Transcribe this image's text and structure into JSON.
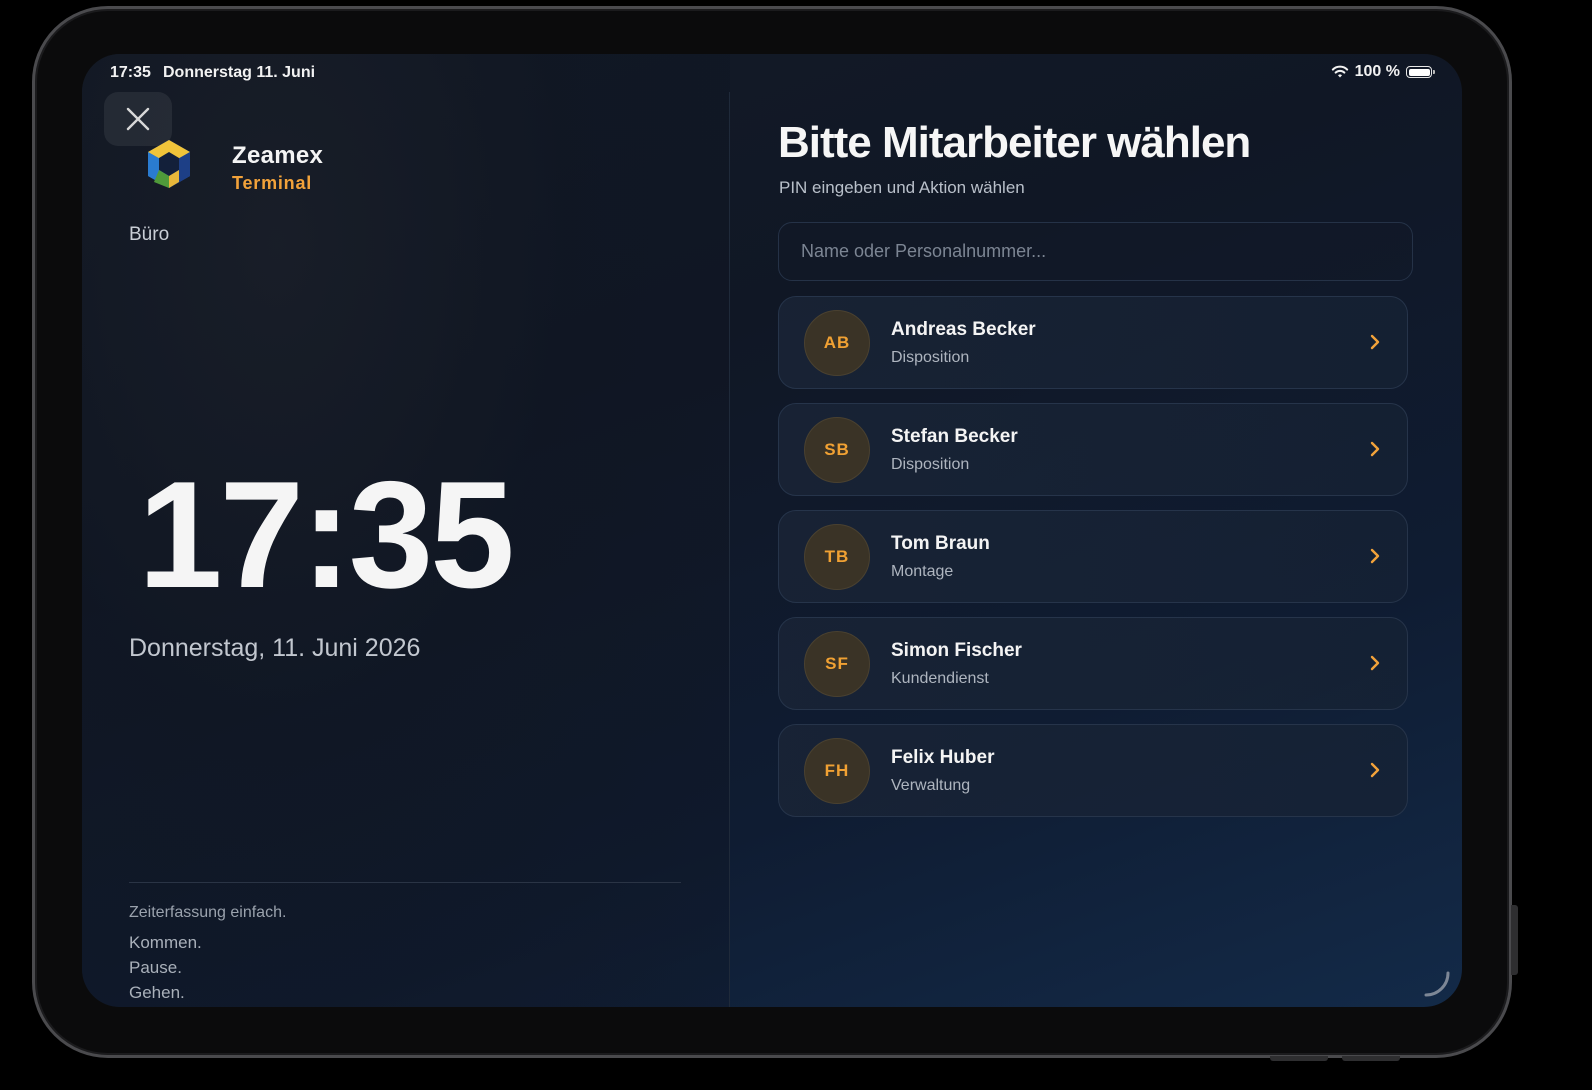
{
  "status_bar": {
    "time": "17:35",
    "date": "Donnerstag 11. Juni",
    "battery": "100 %"
  },
  "brand": {
    "name": "Zeamex",
    "subtitle": "Terminal"
  },
  "location": "Büro",
  "clock": {
    "time": "17:35",
    "date": "Donnerstag, 11. Juni 2026"
  },
  "footer": {
    "tagline": "Zeiterfassung einfach.",
    "steps": [
      "Kommen.",
      "Pause.",
      "Gehen."
    ]
  },
  "panel": {
    "title": "Bitte Mitarbeiter wählen",
    "subtitle": "PIN eingeben und Aktion wählen",
    "search_placeholder": "Name oder Personalnummer...",
    "employees": [
      {
        "initials": "AB",
        "name": "Andreas Becker",
        "department": "Disposition"
      },
      {
        "initials": "SB",
        "name": "Stefan Becker",
        "department": "Disposition"
      },
      {
        "initials": "TB",
        "name": "Tom Braun",
        "department": "Montage"
      },
      {
        "initials": "SF",
        "name": "Simon Fischer",
        "department": "Kundendienst"
      },
      {
        "initials": "FH",
        "name": "Felix Huber",
        "department": "Verwaltung"
      }
    ]
  },
  "colors": {
    "accent": "#f2a23a",
    "background": "#101725",
    "card": "#19243a"
  },
  "icons": {
    "close": "close-icon",
    "wifi": "wifi-icon",
    "battery": "battery-icon",
    "chevron": "chevron-right-icon",
    "logo": "zeamex-logo"
  }
}
